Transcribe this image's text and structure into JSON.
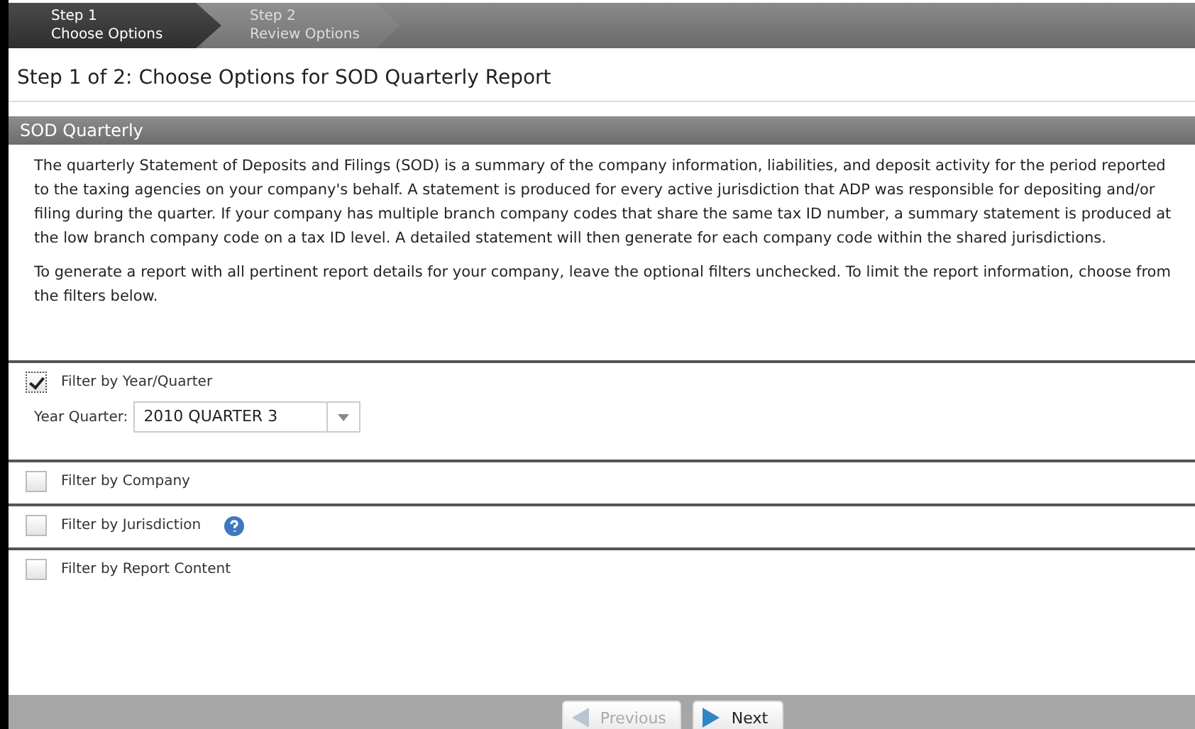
{
  "wizard_steps": [
    {
      "step": "Step 1",
      "label": "Choose Options",
      "selected": true
    },
    {
      "step": "Step 2",
      "label": "Review Options",
      "selected": false
    }
  ],
  "page_title": "Step 1 of 2: Choose Options for SOD Quarterly Report",
  "section": {
    "title": "SOD Quarterly",
    "paragraphs": [
      "The quarterly Statement of Deposits and Filings (SOD) is a summary of the company information, liabilities, and deposit activity for the period reported to the taxing agencies on your company's behalf. A statement is produced for every active jurisdiction that ADP was responsible for depositing and/or filing during the quarter. If your company has multiple branch company codes that share the same tax ID number, a summary statement is produced at the low branch company code on a tax ID level. A detailed statement will then generate for each company code within the shared jurisdictions.",
      "To generate a report with all pertinent report details for your company, leave the optional filters unchecked. To limit the report information, choose from the filters below."
    ]
  },
  "filters": [
    {
      "label": "Filter by Year/Quarter",
      "checked": true,
      "field": {
        "label": "Year Quarter:",
        "value": "2010 QUARTER 3"
      }
    },
    {
      "label": "Filter by Company",
      "checked": false
    },
    {
      "label": "Filter by Jurisdiction",
      "checked": false,
      "help": true
    },
    {
      "label": "Filter by Report Content",
      "checked": false
    }
  ],
  "buttons": [
    {
      "label": "Previous",
      "disabled": true
    },
    {
      "label": "Next",
      "disabled": false
    }
  ]
}
